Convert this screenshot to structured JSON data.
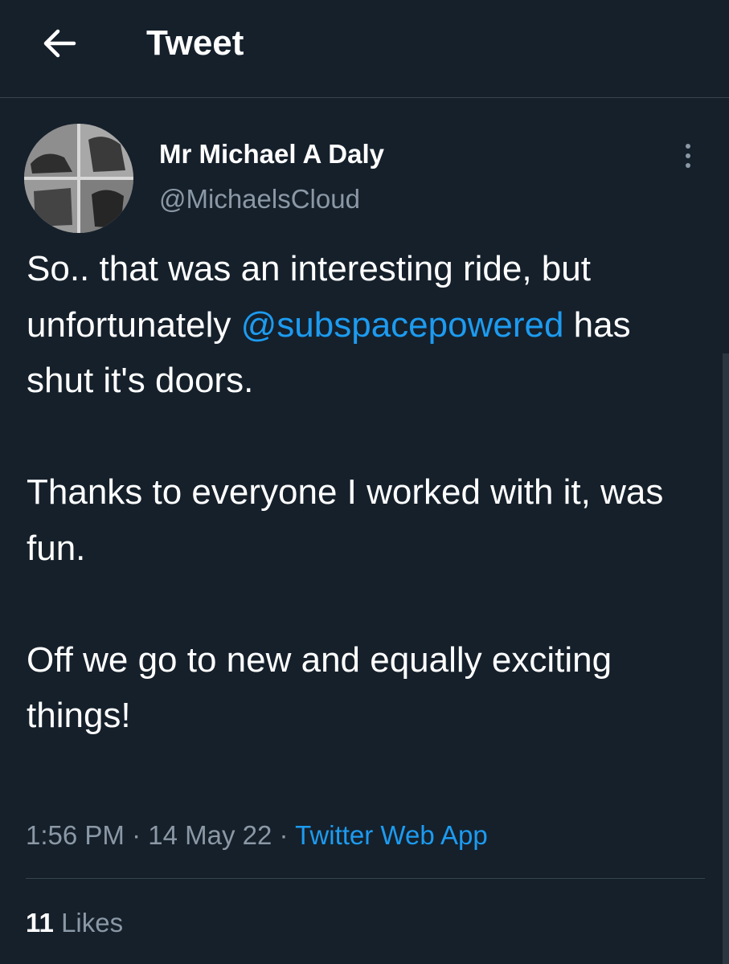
{
  "header": {
    "title": "Tweet",
    "back_icon": "arrow-left-icon"
  },
  "author": {
    "display_name": "Mr Michael A Daly",
    "handle": "@MichaelsCloud"
  },
  "tweet": {
    "line1": "So.. that was an interesting ride, but unfortunately ",
    "mention": "@subspacepowered",
    "line1_end": " has shut it's doors.",
    "para2": "Thanks to everyone I worked with it, was fun.",
    "para3": "Off we go to new and equally exciting things!"
  },
  "meta": {
    "time": "1:56 PM",
    "separator": " · ",
    "date": "14 May 22",
    "source": "Twitter Web App"
  },
  "engagement": {
    "likes_count": "11",
    "likes_label": "Likes"
  },
  "colors": {
    "background": "#15202b",
    "accent": "#1d9bf0",
    "secondary_text": "#8b98a5",
    "border": "#38444d"
  }
}
